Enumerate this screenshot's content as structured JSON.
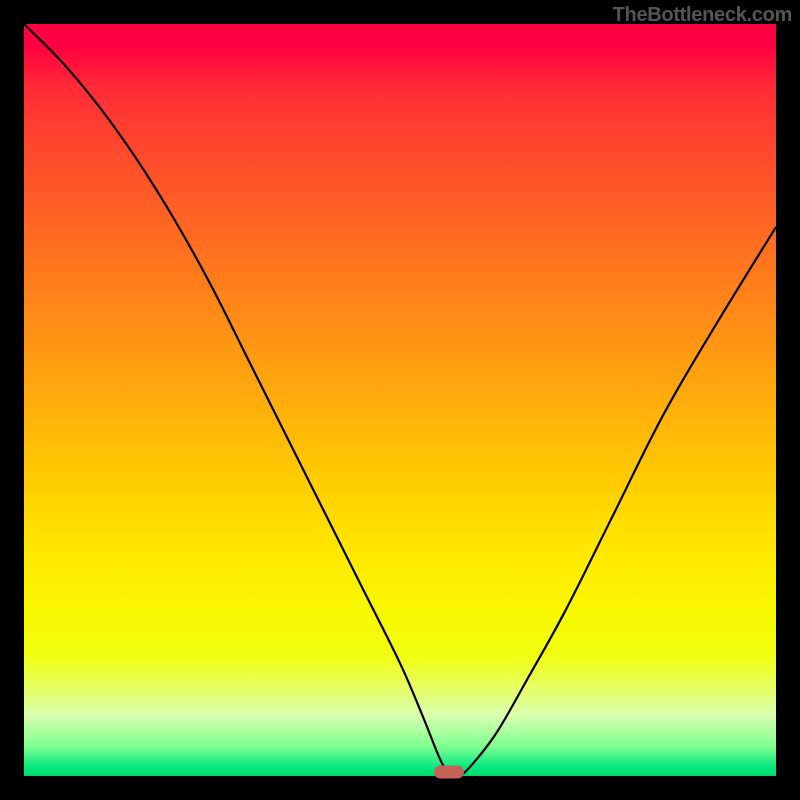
{
  "attribution": "TheBottleneck.com",
  "chart_data": {
    "type": "line",
    "title": "",
    "xlabel": "",
    "ylabel": "",
    "xlim": [
      0,
      100
    ],
    "ylim": [
      0,
      100
    ],
    "series": [
      {
        "name": "bottleneck-curve",
        "x": [
          0,
          5,
          10,
          15,
          20,
          25,
          30,
          35,
          40,
          45,
          50,
          53,
          55,
          56,
          57,
          58,
          60,
          63,
          67,
          72,
          78,
          85,
          92,
          100
        ],
        "values": [
          100,
          95,
          89,
          82,
          74,
          65,
          55,
          45,
          35,
          25,
          15,
          8,
          3,
          1,
          0,
          0,
          2,
          6,
          13,
          22,
          34,
          48,
          60,
          73
        ]
      }
    ],
    "gradient_stops": [
      {
        "pos": 0,
        "color": "#ff0040"
      },
      {
        "pos": 50,
        "color": "#ffc800"
      },
      {
        "pos": 85,
        "color": "#f0ff10"
      },
      {
        "pos": 100,
        "color": "#00d868"
      }
    ],
    "marker": {
      "x": 56.5,
      "y": 0.5,
      "color": "#c66358"
    }
  }
}
